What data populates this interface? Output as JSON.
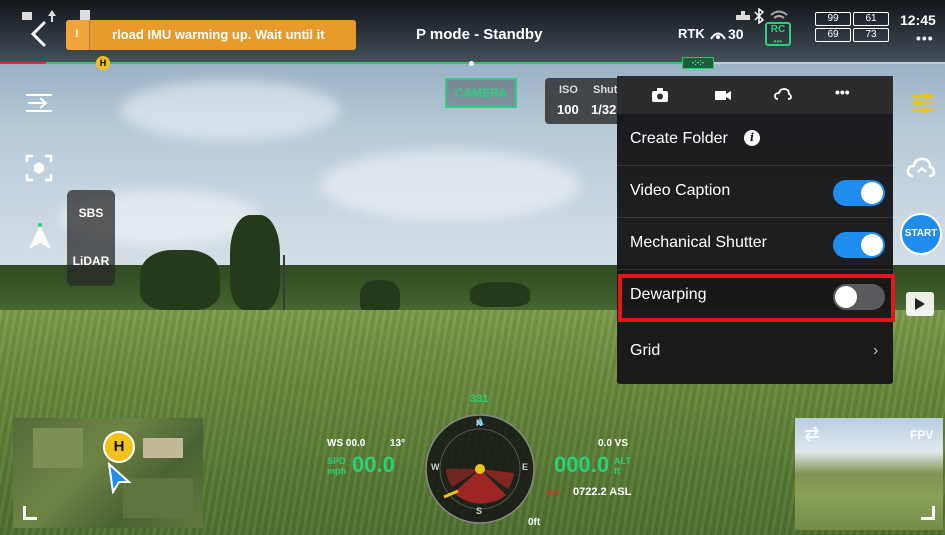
{
  "status_bar": {
    "warning_text": "rload IMU warming up. Wait until it",
    "warning_chip": "!",
    "flight_mode": "P mode - Standby",
    "rtk_label": "RTK",
    "satellite_count": "30",
    "rc_label": "RC",
    "battery_1_top": "99",
    "battery_1_bottom": "69",
    "battery_2_top": "61",
    "battery_2_bottom": "73",
    "clock": "12:45",
    "more_dots": "•••"
  },
  "progress": {
    "home_marker": "H",
    "end_marker": "-:-:-"
  },
  "left_rail": {
    "mode_options": [
      "SBS",
      "LiDAR"
    ]
  },
  "camera": {
    "camera_tag": "CAMERA",
    "iso_label": "ISO",
    "iso_value": "100",
    "shutter_label": "Shut",
    "shutter_value": "1/32"
  },
  "settings_menu": {
    "tabs": [
      "photo-icon",
      "video-icon",
      "cloud-icon",
      "more-icon"
    ],
    "more_tab_label": "•••",
    "rows": [
      {
        "label": "Create Folder",
        "info": "i"
      },
      {
        "label": "Video Caption",
        "toggle": "on"
      },
      {
        "label": "Mechanical Shutter",
        "toggle": "on"
      },
      {
        "label": "Dewarping",
        "toggle": "off"
      },
      {
        "label": "Grid",
        "chevron": "›"
      }
    ]
  },
  "right_rail": {
    "start_label": "START"
  },
  "minimap": {
    "home_label": "H"
  },
  "telemetry": {
    "ws_label": "WS 00.0",
    "ws_angle": "13°",
    "spd_label": "SPD",
    "spd_unit": "mph",
    "speed_value": "00.0",
    "vs_label": "0.0 VS",
    "alt_value": "000.0",
    "alt_unit": "ft",
    "alt_label": "ALT",
    "asl_value": "0722.2 ASL",
    "bottom_distance": "0ft",
    "heading_value": "331",
    "marker_left": "0.0"
  },
  "compass": {
    "north": "N",
    "south": "S",
    "east": "E",
    "west": "W"
  },
  "fpv": {
    "label": "FPV"
  },
  "colors": {
    "accent_blue": "#1f8cf0",
    "warning_orange": "#e89a2b",
    "highlight_red": "#e4161c",
    "telemetry_green": "#29d17a"
  }
}
